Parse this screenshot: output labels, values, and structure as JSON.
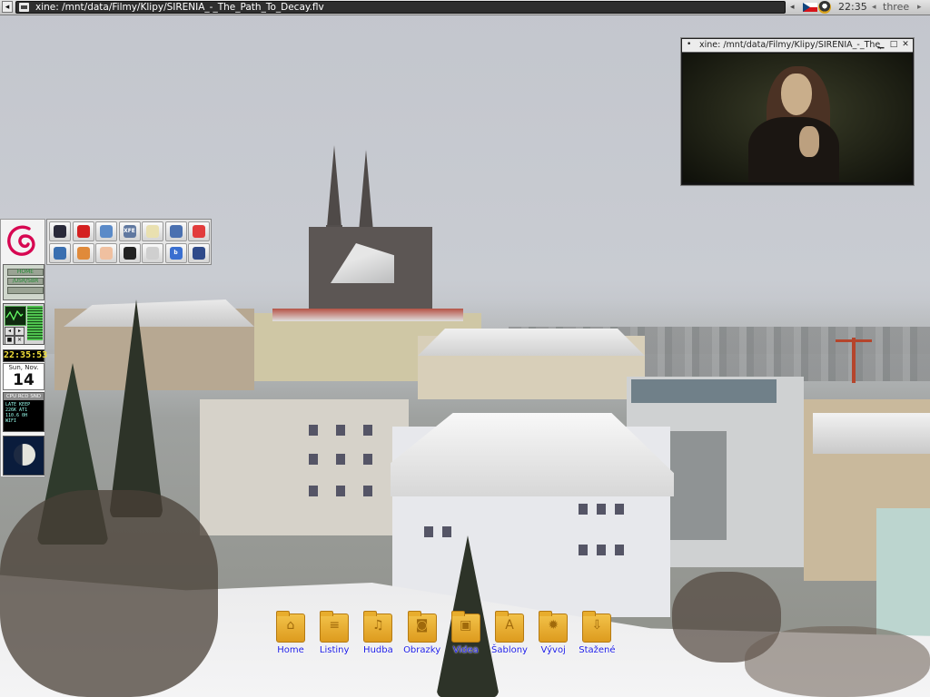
{
  "panel": {
    "menu_glyph": "◂",
    "task_title": "xine: /mnt/data/Filmy/Klipy/SIRENIA_-_The_Path_To_Decay.flv",
    "clock": "22:35",
    "workspace": "three",
    "ws_prev_glyph": "◂",
    "ws_next_glyph": "▸",
    "tray_arrow_glyph": "◂"
  },
  "xine_window": {
    "title": "xine: /mnt/data/Filmy/Klipy/SIRENIA_-_The_",
    "bullet": "•",
    "min_glyph": "▁",
    "max_glyph": "□",
    "close_glyph": "✕"
  },
  "dock": {
    "clock": "22:35:53",
    "weekday": "Sun, Nov.",
    "day": "14",
    "disk_labels": [
      "HOME",
      "/USR/SBR",
      ""
    ],
    "net_header": "CPU  RCD  SND",
    "net_lines": [
      "LATE  KEEP",
      "226K  AT1",
      "110.6 0H",
      "WIFI"
    ],
    "cpu_buttons": [
      "◂",
      "▸",
      "■",
      "✕"
    ]
  },
  "launchers": [
    {
      "name": "terminal-icon",
      "color": "#2a2a3a"
    },
    {
      "name": "opera-icon",
      "color": "#d42020"
    },
    {
      "name": "pidgin-icon",
      "color": "#5a8ac8"
    },
    {
      "name": "xfe-icon",
      "color": "#6078a0",
      "text": "XFE"
    },
    {
      "name": "editor-icon",
      "color": "#e9e0b0"
    },
    {
      "name": "network-icon",
      "color": "#4a70b0"
    },
    {
      "name": "palette-icon",
      "color": "#e23c3c"
    },
    {
      "name": "openoffice-icon",
      "color": "#3a6fb0"
    },
    {
      "name": "gimp-icon",
      "color": "#e08a3a"
    },
    {
      "name": "eye-icon",
      "color": "#f0c0a0"
    },
    {
      "name": "inkscape-icon",
      "color": "#222222"
    },
    {
      "name": "calculator-icon",
      "color": "#cfcfcf"
    },
    {
      "name": "bluefish-icon",
      "color": "#3a6fd0",
      "text": "b"
    },
    {
      "name": "video-clapper-icon",
      "color": "#2f4a8a"
    }
  ],
  "folders": [
    {
      "label": "Home",
      "icon": "home-icon",
      "sym": "⌂"
    },
    {
      "label": "Listiny",
      "icon": "document-icon",
      "sym": "≡"
    },
    {
      "label": "Hudba",
      "icon": "music-icon",
      "sym": "♫"
    },
    {
      "label": "Obrazky",
      "icon": "camera-icon",
      "sym": "◙"
    },
    {
      "label": "Videa",
      "icon": "film-icon",
      "sym": "▣"
    },
    {
      "label": "Šablony",
      "icon": "compass-icon",
      "sym": "A"
    },
    {
      "label": "Vývoj",
      "icon": "gear-icon",
      "sym": "✹"
    },
    {
      "label": "Stažené",
      "icon": "download-icon",
      "sym": "⇩"
    }
  ]
}
